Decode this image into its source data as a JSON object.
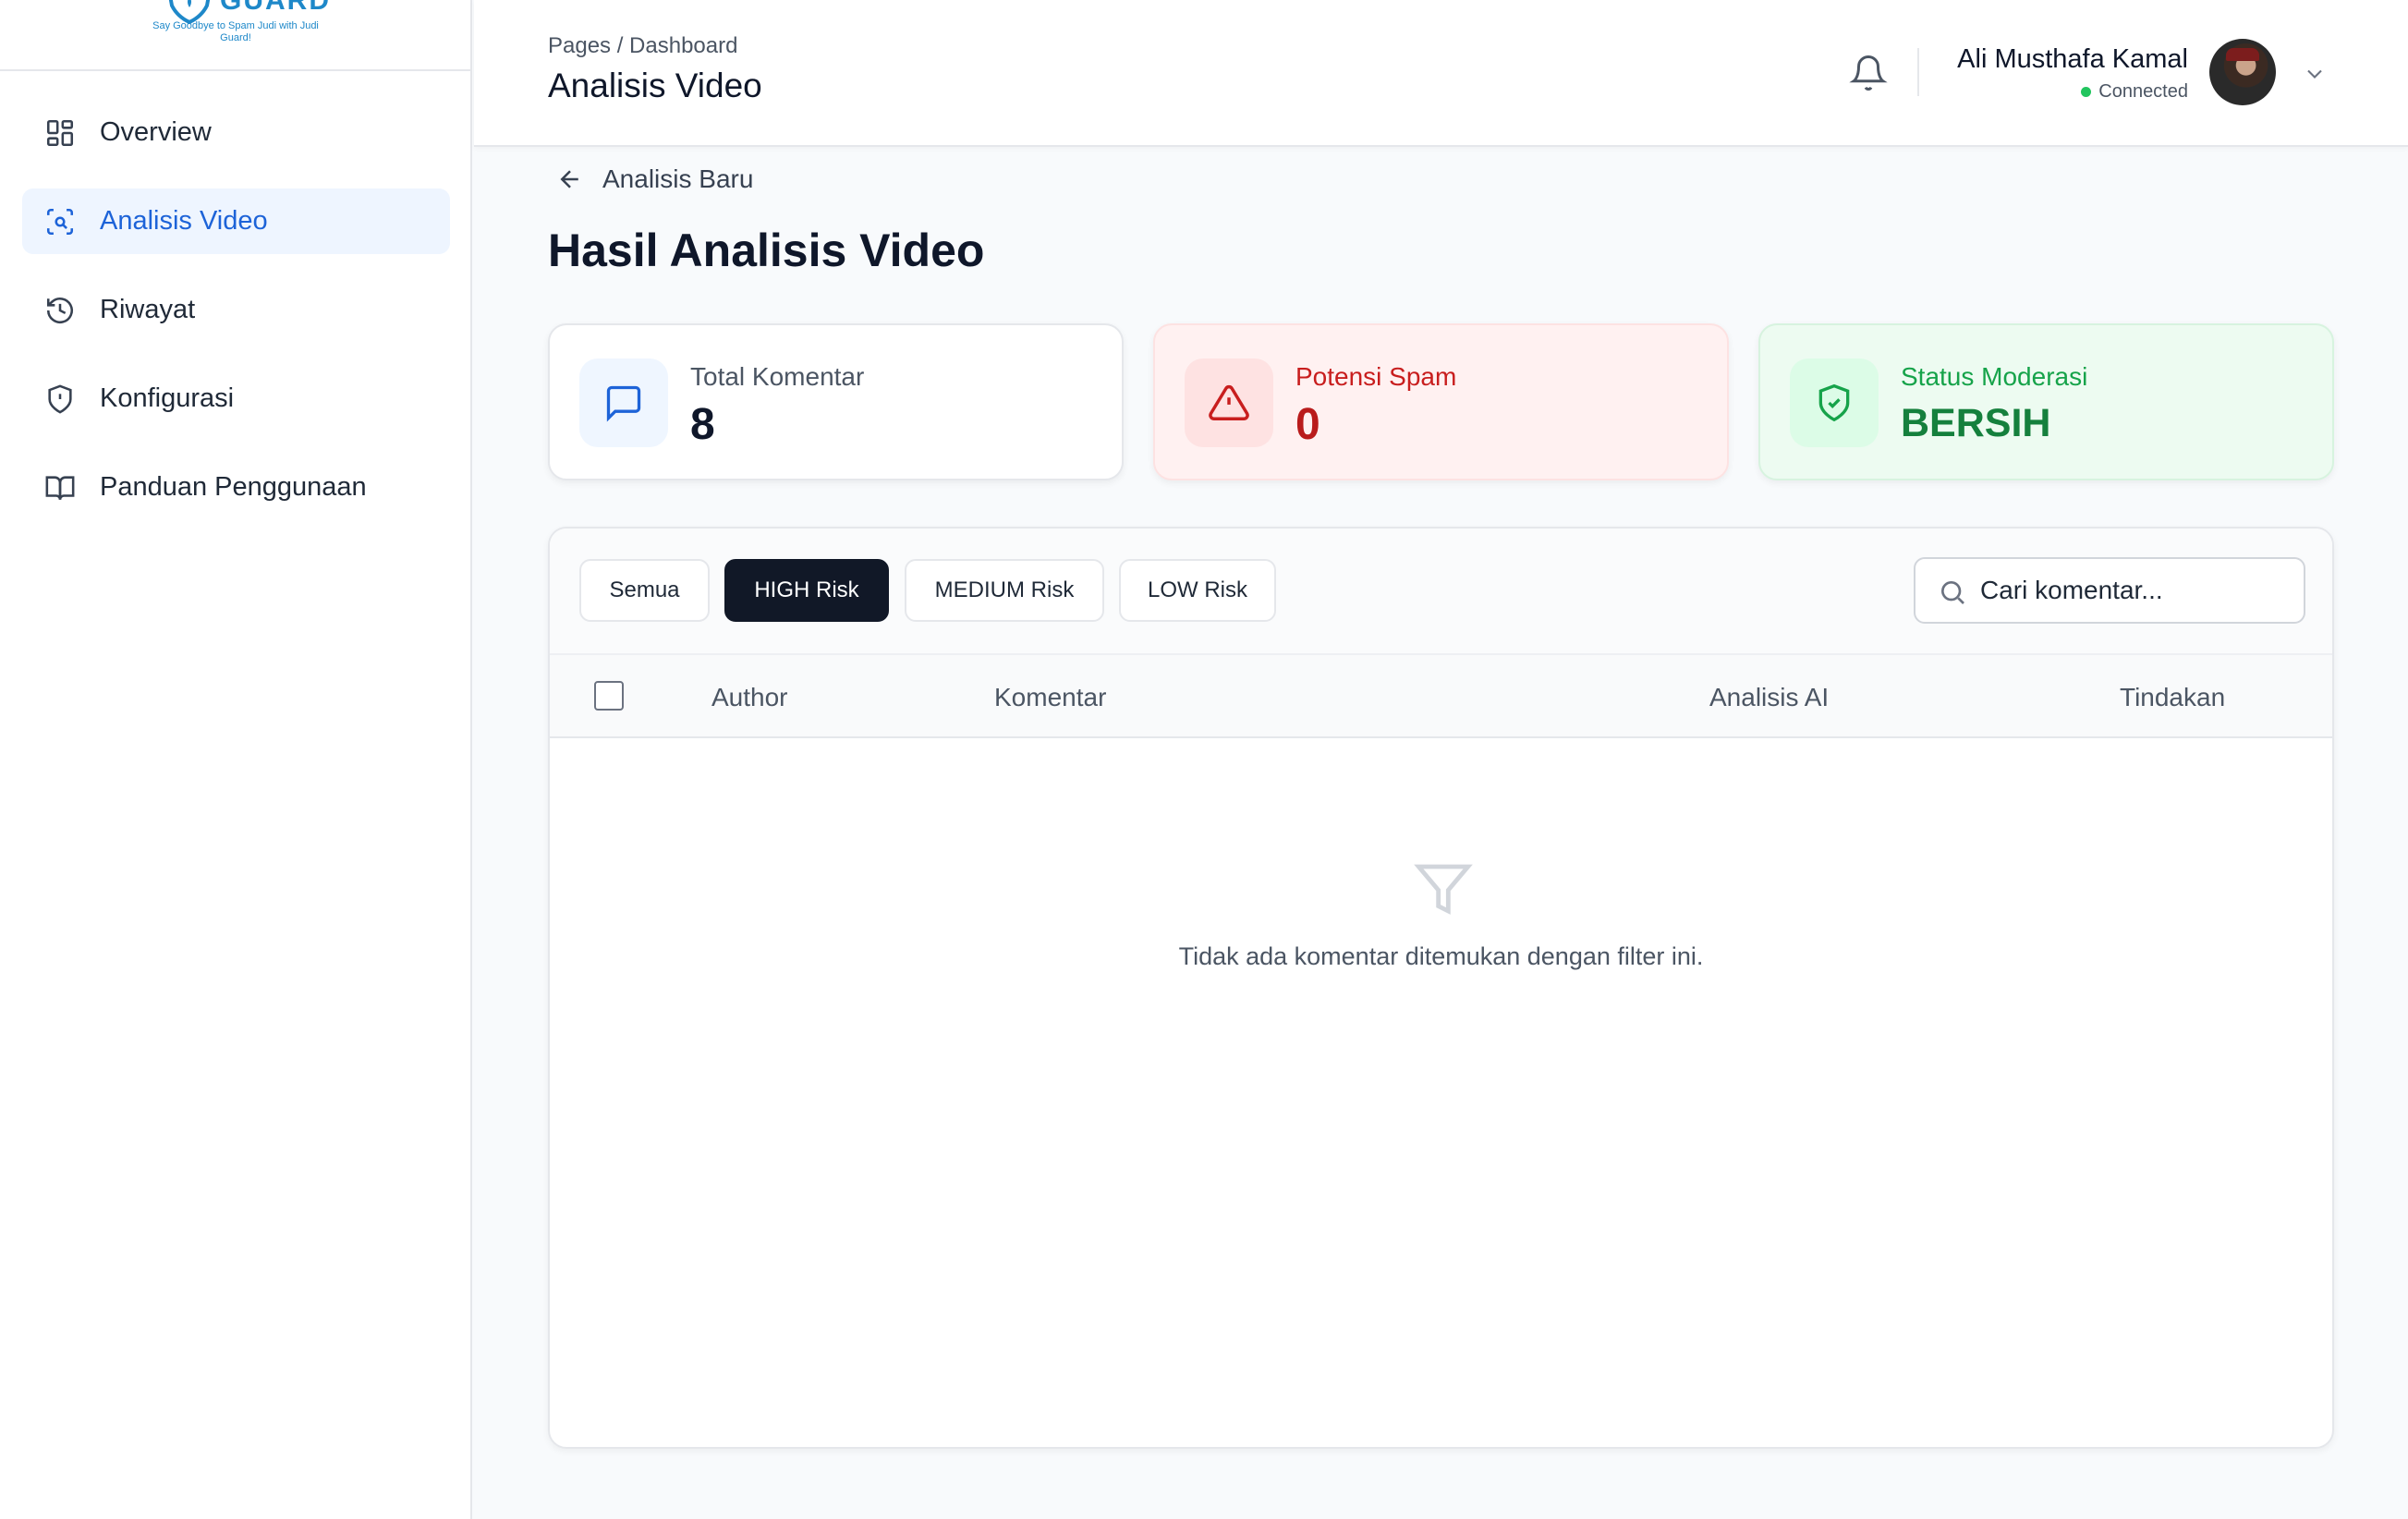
{
  "brand": {
    "name": "GUARD",
    "tagline": "Say Goodbye to Spam Judi with Judi Guard!"
  },
  "sidebar": {
    "items": [
      {
        "label": "Overview",
        "icon": "layout-grid-icon",
        "active": false
      },
      {
        "label": "Analisis Video",
        "icon": "scan-search-icon",
        "active": true
      },
      {
        "label": "Riwayat",
        "icon": "history-icon",
        "active": false
      },
      {
        "label": "Konfigurasi",
        "icon": "shield-alert-icon",
        "active": false
      },
      {
        "label": "Panduan Penggunaan",
        "icon": "book-open-icon",
        "active": false
      }
    ]
  },
  "header": {
    "breadcrumb": "Pages / Dashboard",
    "title": "Analisis Video",
    "user": {
      "name": "Ali Musthafa Kamal",
      "status": "Connected"
    }
  },
  "main": {
    "back_label": "Analisis Baru",
    "title": "Hasil Analisis Video",
    "stats": {
      "total": {
        "label": "Total Komentar",
        "value": "8"
      },
      "spam": {
        "label": "Potensi Spam",
        "value": "0"
      },
      "moderation": {
        "label": "Status Moderasi",
        "value": "BERSIH"
      }
    },
    "filters": [
      {
        "label": "Semua",
        "active": false
      },
      {
        "label": "HIGH Risk",
        "active": true
      },
      {
        "label": "MEDIUM Risk",
        "active": false
      },
      {
        "label": "LOW Risk",
        "active": false
      }
    ],
    "search": {
      "placeholder": "Cari komentar...",
      "value": ""
    },
    "table": {
      "columns": [
        "Author",
        "Komentar",
        "Analisis AI",
        "Tindakan"
      ],
      "rows": [],
      "empty_message": "Tidak ada komentar ditemukan dengan filter ini."
    }
  },
  "colors": {
    "accent": "#1d63d8",
    "danger": "#c81e1e",
    "success": "#16a34a",
    "dark": "#111827"
  }
}
